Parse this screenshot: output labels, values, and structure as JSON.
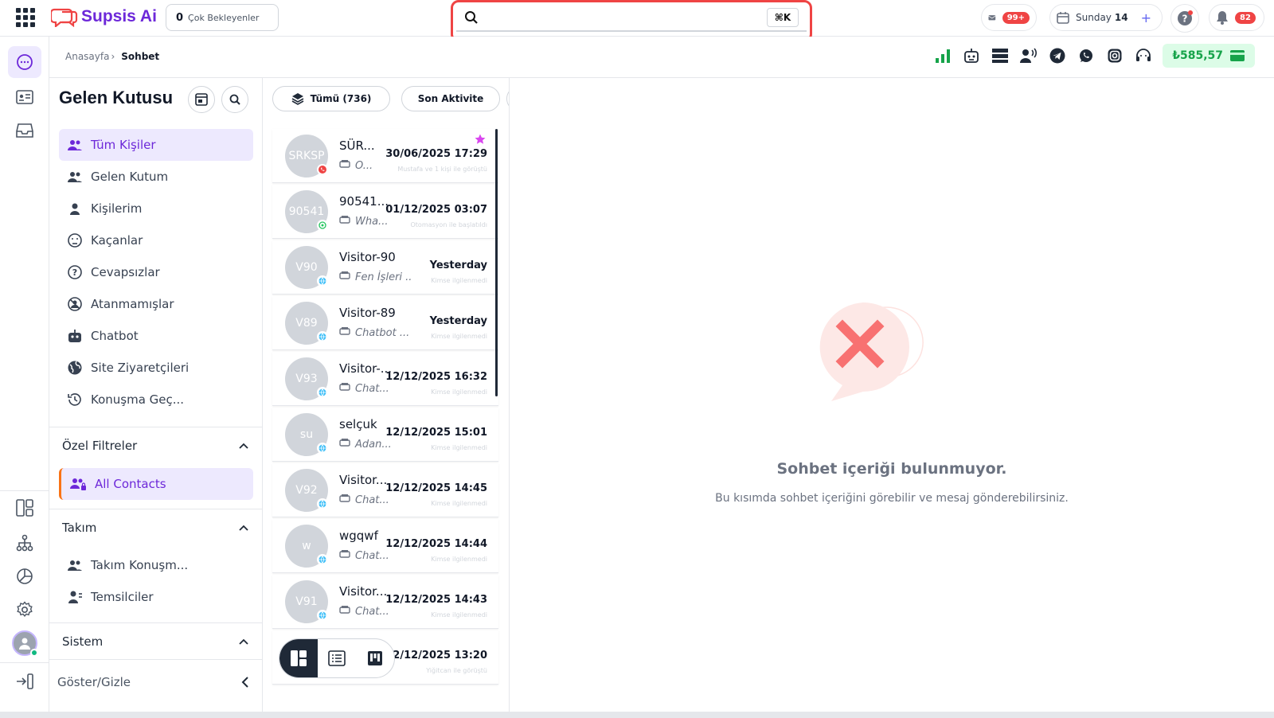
{
  "app": {
    "name": "Supsis Ai"
  },
  "topbar": {
    "pending_count": "0",
    "pending_label": "Çok Bekleyenler",
    "search_placeholder": "",
    "search_shortcut": "⌘K",
    "mail_badge": "99+",
    "calendar_day": "Sunday",
    "calendar_date": "14",
    "notif_badge": "82"
  },
  "breadcrumb": {
    "home": "Anasayfa",
    "sep": "›",
    "current": "Sohbet"
  },
  "balance": "₺585,57",
  "inbox": {
    "title": "Gelen Kutusu",
    "items": [
      {
        "label": "Tüm Kişiler"
      },
      {
        "label": "Gelen Kutum"
      },
      {
        "label": "Kişilerim"
      },
      {
        "label": "Kaçanlar"
      },
      {
        "label": "Cevapsızlar"
      },
      {
        "label": "Atanmamışlar"
      },
      {
        "label": "Chatbot"
      },
      {
        "label": "Site Ziyaretçileri"
      },
      {
        "label": "Konuşma Geç..."
      }
    ],
    "custom_filters": {
      "title": "Özel Filtreler",
      "items": [
        {
          "label": "All Contacts"
        }
      ]
    },
    "team": {
      "title": "Takım",
      "items": [
        {
          "label": "Takım Konuşm..."
        },
        {
          "label": "Temsilciler"
        }
      ]
    },
    "system": {
      "title": "Sistem"
    },
    "toggle": "Göster/Gizle"
  },
  "list": {
    "filter_all": "Tümü (736)",
    "sort_label": "Son Aktivite",
    "conversations": [
      {
        "avatar": "SRKSP",
        "name": "SÜR...",
        "date": "30/06/2025 17:29",
        "sub": "O...",
        "note": "Mustafa ve 1 kişi ile görüştü",
        "channel": "whatsapp-red"
      },
      {
        "avatar": "90541",
        "name": "90541...",
        "date": "01/12/2025 03:07",
        "sub": "Wha...",
        "note": "Otomasyon ile başlatıldı",
        "channel": "whatsapp"
      },
      {
        "avatar": "V90",
        "name": "Visitor-90",
        "date": "Yesterday",
        "sub": "Fen İşleri ...",
        "note": "Kimse ilgilenmedi",
        "channel": "web"
      },
      {
        "avatar": "V89",
        "name": "Visitor-89",
        "date": "Yesterday",
        "sub": "Chatbot ...",
        "note": "Kimse ilgilenmedi",
        "channel": "web"
      },
      {
        "avatar": "V93",
        "name": "Visitor-...",
        "date": "12/12/2025 16:32",
        "sub": "Chat...",
        "note": "Kimse ilgilenmedi",
        "channel": "web"
      },
      {
        "avatar": "su",
        "name": "selçuk",
        "date": "12/12/2025 15:01",
        "sub": "Adan...",
        "note": "Kimse ilgilenmedi",
        "channel": "web"
      },
      {
        "avatar": "V92",
        "name": "Visitor...",
        "date": "12/12/2025 14:45",
        "sub": "Chat...",
        "note": "Kimse ilgilenmedi",
        "channel": "web"
      },
      {
        "avatar": "w",
        "name": "wgqwf",
        "date": "12/12/2025 14:44",
        "sub": "Chat...",
        "note": "Kimse ilgilenmedi",
        "channel": "web"
      },
      {
        "avatar": "V91",
        "name": "Visitor...",
        "date": "12/12/2025 14:43",
        "sub": "Chat...",
        "note": "Kimse ilgilenmedi",
        "channel": "web"
      },
      {
        "avatar": "",
        "name": "",
        "date": "12/12/2025 13:20",
        "sub": "",
        "note": "Yiğitcan ile görüştü",
        "channel": ""
      }
    ]
  },
  "empty_state": {
    "title": "Sohbet içeriği bulunmuyor.",
    "description": "Bu kısımda sohbet içeriğini görebilir ve mesaj gönderebilirsiniz."
  },
  "colors": {
    "accent": "#6d28d9",
    "accent_bg": "#ede9fe",
    "danger": "#ef4444",
    "success": "#16a34a"
  }
}
